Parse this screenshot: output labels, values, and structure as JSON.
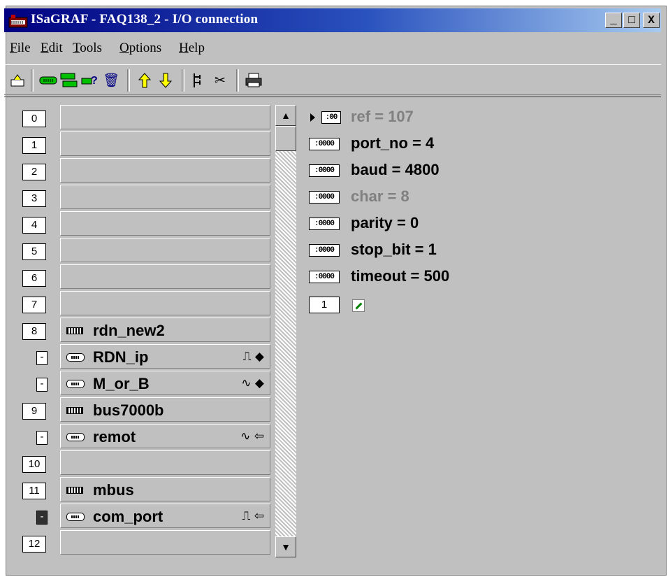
{
  "window": {
    "title": "ISaGRAF - FAQ138_2 - I/O connection",
    "controls": {
      "minimize": "_",
      "maximize": "□",
      "close": "X"
    }
  },
  "menu": [
    {
      "label": "File"
    },
    {
      "label": "Edit"
    },
    {
      "label": "Tools"
    },
    {
      "label": "Options"
    },
    {
      "label": "Help"
    }
  ],
  "toolbar": {
    "icons": [
      "open-icon",
      "board-icon",
      "complex-board-icon",
      "help-board-icon",
      "delete-icon",
      "move-up-icon",
      "move-down-icon",
      "structure-icon",
      "cut-icon",
      "print-icon"
    ],
    "glyphs": {
      "up": "⇧",
      "down": "⇩",
      "cut": "✂",
      "delete": "🗑",
      "print": "🖶"
    }
  },
  "slots": [
    {
      "num": "0",
      "name": "",
      "sub": false
    },
    {
      "num": "1",
      "name": "",
      "sub": false
    },
    {
      "num": "2",
      "name": "",
      "sub": false
    },
    {
      "num": "3",
      "name": "",
      "sub": false
    },
    {
      "num": "4",
      "name": "",
      "sub": false
    },
    {
      "num": "5",
      "name": "",
      "sub": false
    },
    {
      "num": "6",
      "name": "",
      "sub": false
    },
    {
      "num": "7",
      "name": "",
      "sub": false
    },
    {
      "num": "8",
      "name": "rdn_new2",
      "sub": false,
      "icon": "board-icon"
    },
    {
      "num": "-",
      "name": "RDN_ip",
      "sub": true,
      "icon": "complex-board-icon",
      "signal": "⎍ ◆"
    },
    {
      "num": "-",
      "name": "M_or_B",
      "sub": true,
      "icon": "complex-board-icon",
      "signal": "∿ ◆"
    },
    {
      "num": "9",
      "name": "bus7000b",
      "sub": false,
      "icon": "board-icon"
    },
    {
      "num": "-",
      "name": "remot",
      "sub": true,
      "icon": "complex-board-icon",
      "signal": "∿ ⇦"
    },
    {
      "num": "10",
      "name": "",
      "sub": false
    },
    {
      "num": "11",
      "name": "mbus",
      "sub": false,
      "icon": "board-icon"
    },
    {
      "num": "-",
      "name": "com_port",
      "sub": true,
      "icon": "complex-board-icon",
      "signal": "⎍ ⇦",
      "selected": true
    },
    {
      "num": "12",
      "name": "",
      "sub": false
    }
  ],
  "scrollbar": {
    "up": "▲",
    "down": "▼"
  },
  "params": [
    {
      "text": "ref = 107",
      "icon": ":00",
      "dim": true,
      "arrow": true
    },
    {
      "text": "port_no = 4",
      "icon": ":0000",
      "dim": false
    },
    {
      "text": "baud = 4800",
      "icon": ":0000",
      "dim": false
    },
    {
      "text": "char = 8",
      "icon": ":0000",
      "dim": true
    },
    {
      "text": "parity = 0",
      "icon": ":0000",
      "dim": false
    },
    {
      "text": "stop_bit = 1",
      "icon": ":0000",
      "dim": false
    },
    {
      "text": "timeout = 500",
      "icon": ":0000",
      "dim": false
    }
  ],
  "channel": {
    "num": "1"
  }
}
